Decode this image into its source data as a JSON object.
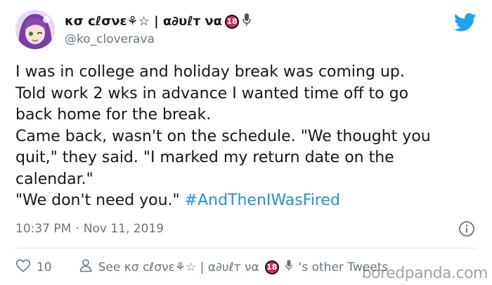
{
  "tweet": {
    "display_name": "κσ cℓσνε⚘☆ | α∂υℓт να",
    "badge": "18",
    "handle": "@ko_cloverava",
    "lines": [
      "I was in college and holiday break was coming up.",
      "Told work 2 wks in advance I wanted time off to go",
      "back home for the break.",
      "Came back, wasn't on the schedule. \"We thought you",
      "quit,\" they said. \"I marked my return date on the",
      "calendar.\"",
      "\"We don't need you.\" "
    ],
    "hashtag": "#AndThenIWasFired",
    "time": "10:37 PM",
    "separator": "·",
    "date": "Nov 11, 2019"
  },
  "actions": {
    "like_count": "10",
    "see_prefix": "See κσ cℓσνε⚘☆ | α∂υℓт να",
    "see_badge": "18",
    "see_suffix": "'s other Tweets"
  },
  "watermark": "boredpanda.com",
  "colors": {
    "twitter_blue": "#1da1f2",
    "hashtag": "#1b95e0",
    "muted": "#657786",
    "badge_red": "#e0245e"
  },
  "icons": [
    "avatar",
    "microphone-icon",
    "twitter-bird-icon",
    "info-icon",
    "heart-icon",
    "person-icon"
  ]
}
